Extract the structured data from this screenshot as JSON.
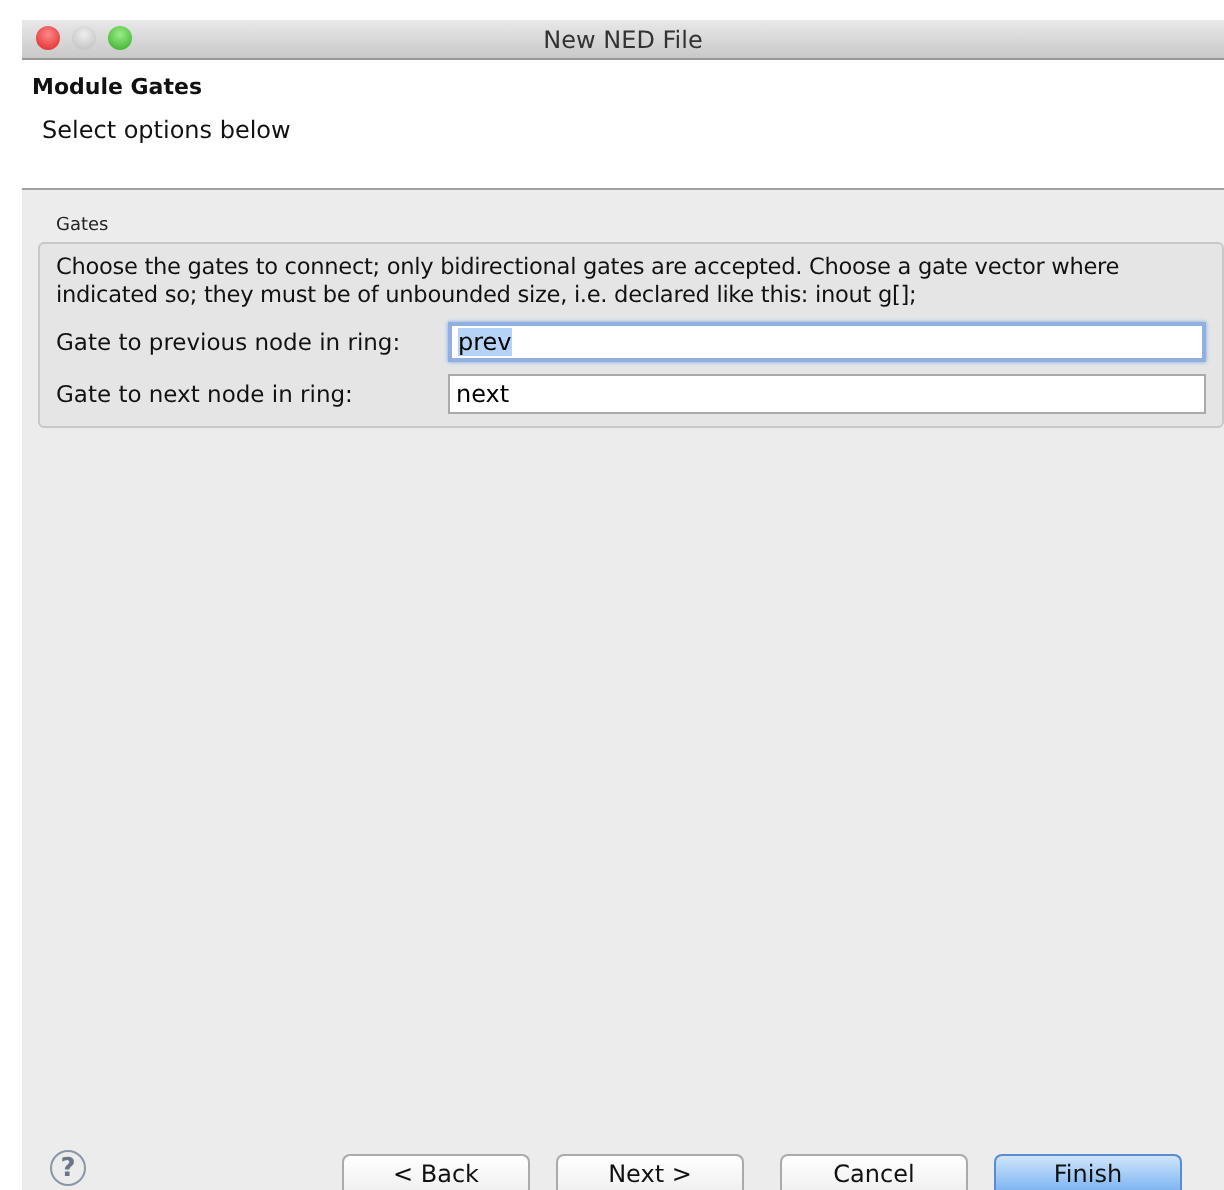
{
  "window": {
    "title": "New NED File"
  },
  "header": {
    "title": "Module Gates",
    "subtitle": "Select options below"
  },
  "group": {
    "title": "Gates",
    "description": "Choose the gates to connect; only bidirectional gates are accepted. Choose a gate vector where indicated so; they must be of unbounded size, i.e. declared like this: inout g[];",
    "fields": [
      {
        "label": "Gate to previous node in ring:",
        "value": "prev",
        "focused": true
      },
      {
        "label": "Gate to next node in ring:",
        "value": "next",
        "focused": false
      }
    ]
  },
  "help": "?",
  "buttons": [
    {
      "label": "< Back",
      "default": false
    },
    {
      "label": "Next >",
      "default": false
    },
    {
      "label": "Cancel",
      "default": false
    },
    {
      "label": "Finish",
      "default": true
    }
  ]
}
